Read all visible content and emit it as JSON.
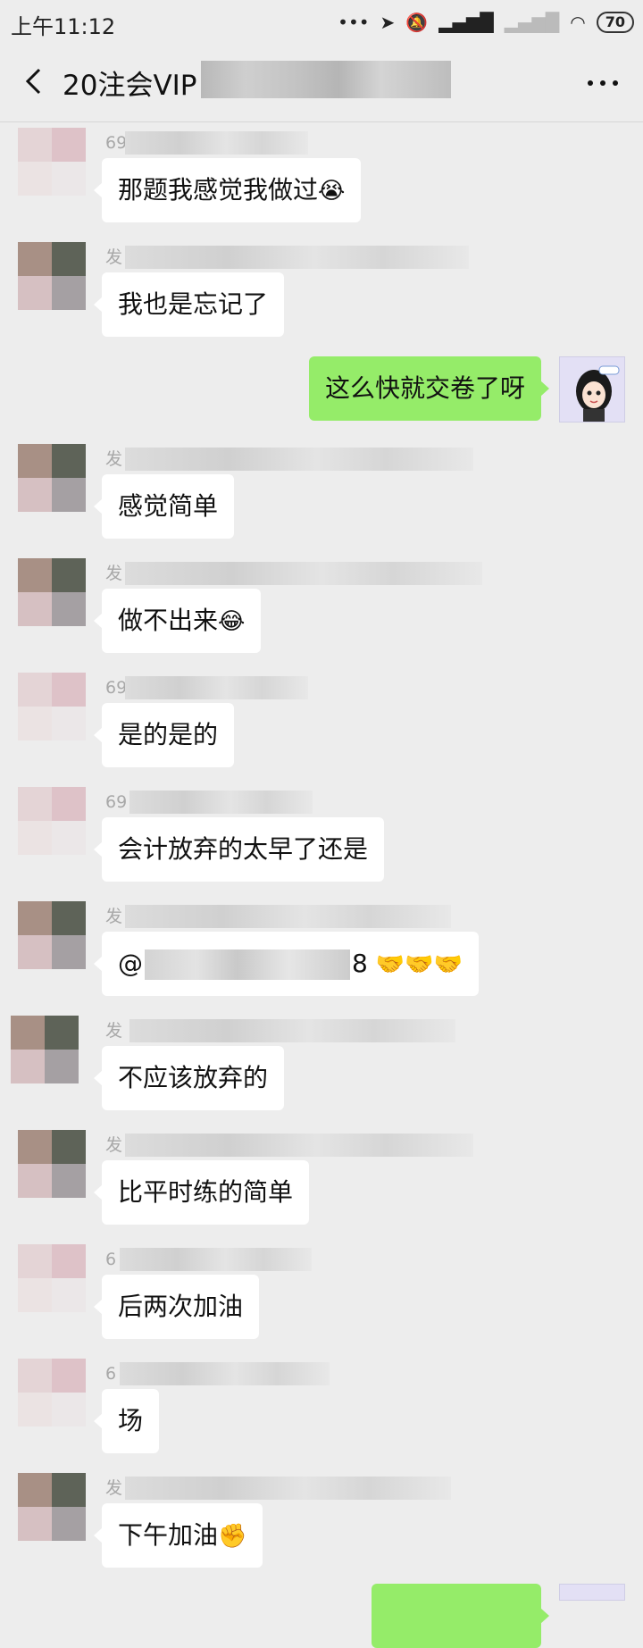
{
  "status": {
    "time": "上午11:12",
    "battery": "70"
  },
  "header": {
    "title": "20注会VIP"
  },
  "messages": [
    {
      "name_prefix": "69",
      "text": "那题我感觉我做过",
      "emoji": "😭"
    },
    {
      "name_prefix": "发",
      "text": "我也是忘记了"
    },
    {
      "text": "这么快就交卷了呀"
    },
    {
      "name_prefix": "发",
      "text": "感觉简单"
    },
    {
      "name_prefix": "发",
      "text": "做不出来",
      "emoji": "😂"
    },
    {
      "name_prefix": "69",
      "text": "是的是的"
    },
    {
      "name_prefix": "69",
      "text": "会计放弃的太早了还是"
    },
    {
      "name_prefix": "发",
      "text_before": "@",
      "text_after": "8",
      "emoji": "🤝🤝🤝"
    },
    {
      "name_prefix": "发",
      "text": "不应该放弃的"
    },
    {
      "name_prefix": "发",
      "text": "比平时练的简单"
    },
    {
      "name_prefix": "6",
      "text": "后两次加油"
    },
    {
      "name_prefix": "6",
      "text": "场"
    },
    {
      "name_prefix": "发",
      "text": "下午加油",
      "emoji": "✊"
    }
  ]
}
